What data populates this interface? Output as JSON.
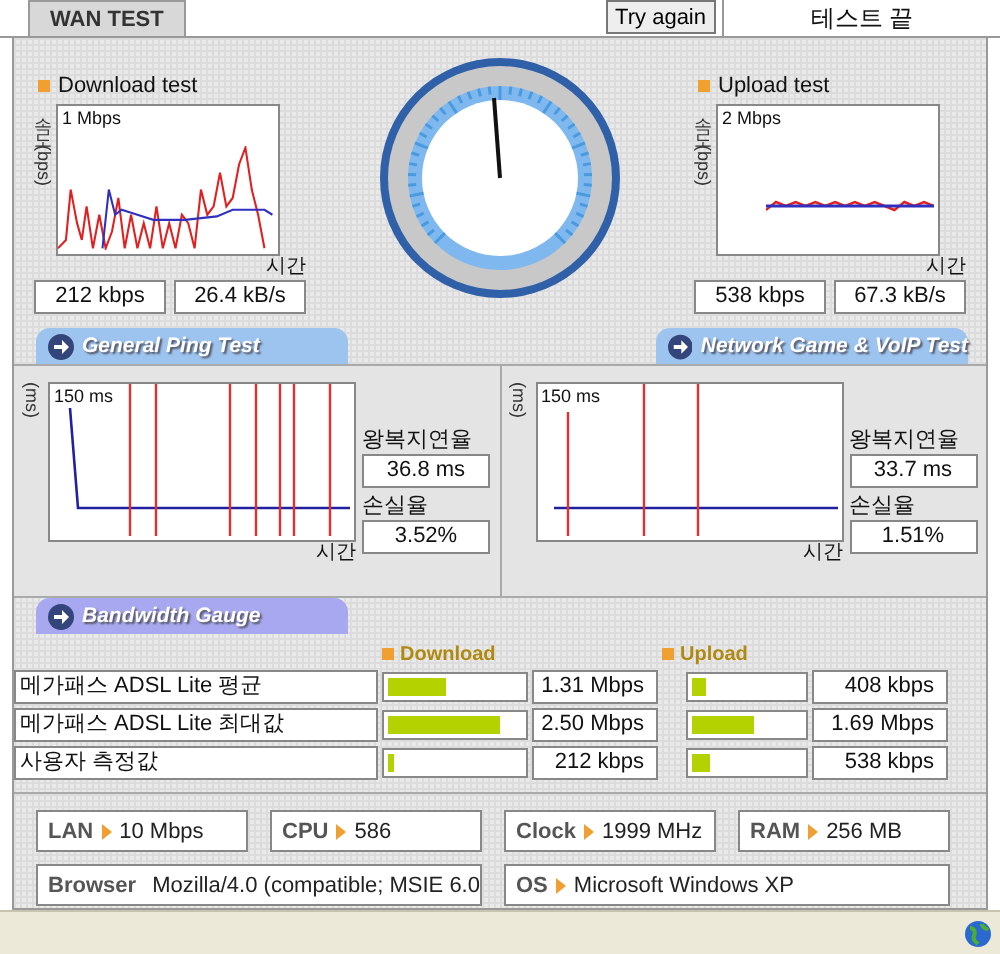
{
  "tab": {
    "label": "WAN TEST",
    "selected": true
  },
  "try_again_button": "Try again",
  "status_text": "테스트 끝",
  "download": {
    "title": "Download test",
    "y_label": "속도 (bps)",
    "scale": "1 Mbps",
    "x_label": "시간",
    "speed": "212 kbps",
    "rate": "26.4 kB/s"
  },
  "upload": {
    "title": "Upload test",
    "y_label": "속도 (bps)",
    "scale": "2 Mbps",
    "x_label": "시간",
    "speed": "538 kbps",
    "rate": "67.3 kB/s"
  },
  "sections": [
    {
      "label": "General Ping Test"
    },
    {
      "label": "Network Game & VoIP Test"
    }
  ],
  "ping": [
    {
      "y_label": "(ms)",
      "scale": "150 ms",
      "x_label": "시간",
      "latency_label": "왕복지연율",
      "latency": "36.8 ms",
      "loss_label": "손실율",
      "loss": "3.52%"
    },
    {
      "y_label": "(ms)",
      "scale": "150 ms",
      "x_label": "시간",
      "latency_label": "왕복지연율",
      "latency": "33.7 ms",
      "loss_label": "손실율",
      "loss": "1.51%"
    }
  ],
  "bandwidth": {
    "title": "Bandwidth Gauge",
    "columns": [
      "Download",
      "Upload"
    ],
    "rows": [
      {
        "label": "메가패스 ADSL Lite 평균",
        "download": {
          "level": 0.43,
          "value": "1.31 Mbps"
        },
        "upload": {
          "level": 0.13,
          "value": "408 kbps"
        }
      },
      {
        "label": "메가패스 ADSL Lite 최대값",
        "download": {
          "level": 0.83,
          "value": "2.50 Mbps"
        },
        "upload": {
          "level": 0.57,
          "value": "1.69 Mbps"
        }
      },
      {
        "label": "사용자 측정값",
        "download": {
          "level": 0.04,
          "value": "212 kbps"
        },
        "upload": {
          "level": 0.17,
          "value": "538 kbps"
        }
      }
    ]
  },
  "system": [
    {
      "label": "LAN",
      "value": "10 Mbps"
    },
    {
      "label": "CPU",
      "value": "586"
    },
    {
      "label": "Clock",
      "value": "1999 MHz"
    },
    {
      "label": "RAM",
      "value": "256 MB"
    },
    {
      "label": "Browser",
      "value": "Mozilla/4.0 (compatible; MSIE 6.0"
    },
    {
      "label": "OS",
      "value": "Microsoft Windows XP"
    }
  ]
}
